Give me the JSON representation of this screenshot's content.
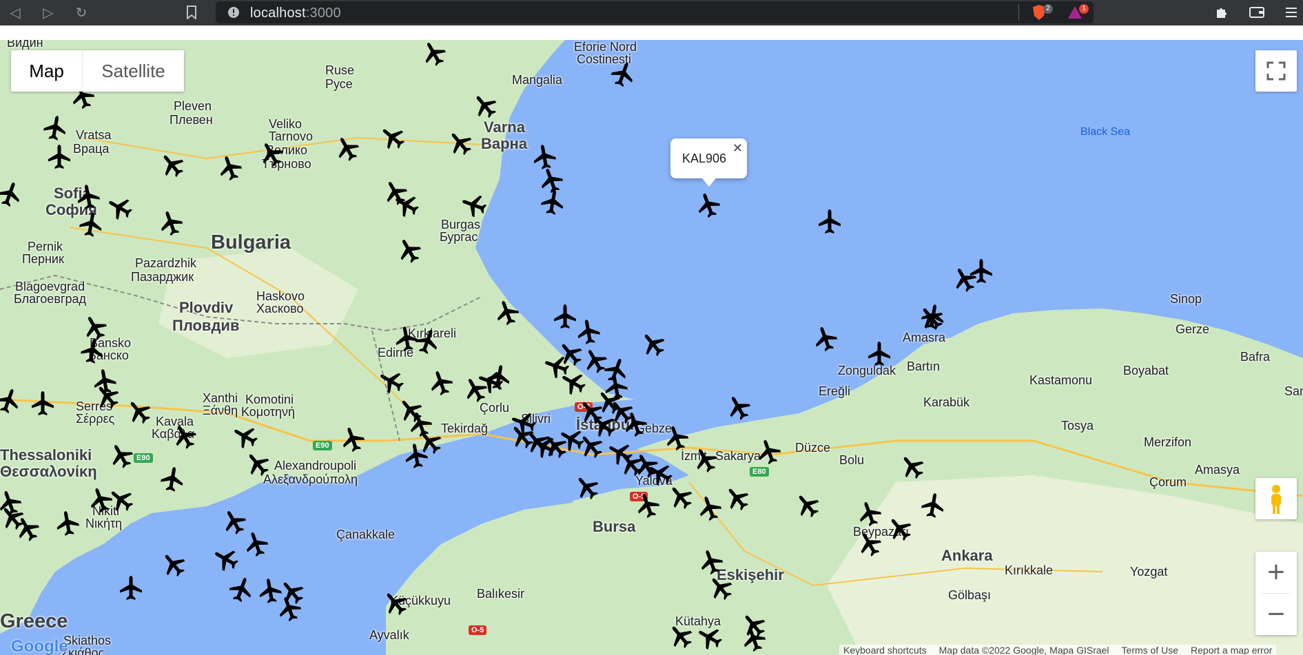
{
  "browser": {
    "url_host": "localhost",
    "url_port": ":3000",
    "brave_badge": "2",
    "rewards_badge": "1"
  },
  "map": {
    "type_control": {
      "map_label": "Map",
      "satellite_label": "Satellite",
      "selected": "Map"
    },
    "info_window": {
      "text": "KAL906"
    },
    "labels": [
      {
        "id": "vidin",
        "text": "Видин",
        "cls": ""
      },
      {
        "id": "eforie",
        "text": "Eforie Nord",
        "cls": ""
      },
      {
        "id": "costinesti",
        "text": "Costinesti",
        "cls": ""
      },
      {
        "id": "ruse",
        "text": "Ruse",
        "cls": ""
      },
      {
        "id": "ruse-cyr",
        "text": "Русе",
        "cls": ""
      },
      {
        "id": "mangalia",
        "text": "Mangalia",
        "cls": ""
      },
      {
        "id": "pleven",
        "text": "Pleven",
        "cls": ""
      },
      {
        "id": "pleven-cyr",
        "text": "Плевен",
        "cls": ""
      },
      {
        "id": "veliko",
        "text": "Veliko",
        "cls": ""
      },
      {
        "id": "tarnovo",
        "text": "Tarnovo",
        "cls": ""
      },
      {
        "id": "veliko-cyr",
        "text": "Велико",
        "cls": ""
      },
      {
        "id": "tarnovo-cyr",
        "text": "Търново",
        "cls": ""
      },
      {
        "id": "varna",
        "text": "Varna",
        "cls": "big"
      },
      {
        "id": "varna-cyr",
        "text": "Варна",
        "cls": "big"
      },
      {
        "id": "vratsa",
        "text": "Vratsa",
        "cls": ""
      },
      {
        "id": "vratsa-cyr",
        "text": "Враца",
        "cls": ""
      },
      {
        "id": "sofia",
        "text": "Sofia",
        "cls": "big"
      },
      {
        "id": "sofia-cyr",
        "text": "София",
        "cls": "big"
      },
      {
        "id": "burgas",
        "text": "Burgas",
        "cls": ""
      },
      {
        "id": "burgas-cyr",
        "text": "Бургас",
        "cls": ""
      },
      {
        "id": "pernik",
        "text": "Pernik",
        "cls": ""
      },
      {
        "id": "pernik-cyr",
        "text": "Перник",
        "cls": ""
      },
      {
        "id": "bulgaria",
        "text": "Bulgaria",
        "cls": "country"
      },
      {
        "id": "pazardzhik",
        "text": "Pazardzhik",
        "cls": ""
      },
      {
        "id": "pazardzhik-cyr",
        "text": "Пазарджик",
        "cls": ""
      },
      {
        "id": "blagoevgrad",
        "text": "Blagoevgrad",
        "cls": ""
      },
      {
        "id": "blagoevgrad-cyr",
        "text": "Благоевград",
        "cls": ""
      },
      {
        "id": "haskovo",
        "text": "Haskovo",
        "cls": ""
      },
      {
        "id": "haskovo-cyr",
        "text": "Хасково",
        "cls": ""
      },
      {
        "id": "plovdiv",
        "text": "Plovdiv",
        "cls": "big"
      },
      {
        "id": "plovdiv-cyr",
        "text": "Пловдив",
        "cls": "big"
      },
      {
        "id": "kirklareli",
        "text": "Kırklareli",
        "cls": ""
      },
      {
        "id": "bansko",
        "text": "Bansko",
        "cls": ""
      },
      {
        "id": "bansko-cyr",
        "text": "Банско",
        "cls": ""
      },
      {
        "id": "edirne",
        "text": "Edirne",
        "cls": ""
      },
      {
        "id": "xanthi",
        "text": "Xanthi",
        "cls": ""
      },
      {
        "id": "xanthi-gr",
        "text": "Ξάνθη",
        "cls": ""
      },
      {
        "id": "komotini",
        "text": "Komotini",
        "cls": ""
      },
      {
        "id": "komotini-gr",
        "text": "Κομοτηνή",
        "cls": ""
      },
      {
        "id": "serres",
        "text": "Serres",
        "cls": ""
      },
      {
        "id": "serres-gr",
        "text": "Σέρρες",
        "cls": ""
      },
      {
        "id": "kavala",
        "text": "Kavala",
        "cls": ""
      },
      {
        "id": "kavala-gr",
        "text": "Καβάλα",
        "cls": ""
      },
      {
        "id": "corlu",
        "text": "Çorlu",
        "cls": ""
      },
      {
        "id": "silivri",
        "text": "Silivri",
        "cls": ""
      },
      {
        "id": "tekirdag",
        "text": "Tekirdağ",
        "cls": ""
      },
      {
        "id": "istanbul",
        "text": "İstanbul",
        "cls": "big"
      },
      {
        "id": "gebze",
        "text": "Gebze",
        "cls": ""
      },
      {
        "id": "izmit",
        "text": "İzmit",
        "cls": ""
      },
      {
        "id": "sakarya",
        "text": "Sakarya",
        "cls": ""
      },
      {
        "id": "duzce",
        "text": "Düzce",
        "cls": ""
      },
      {
        "id": "thessaloniki",
        "text": "Thessaloniki",
        "cls": "big"
      },
      {
        "id": "thessaloniki-gr",
        "text": "Θεσσαλονίκη",
        "cls": "big"
      },
      {
        "id": "alexandroupoli",
        "text": "Alexandroupoli",
        "cls": ""
      },
      {
        "id": "alexandroupoli-gr",
        "text": "Αλεξανδρούπολη",
        "cls": ""
      },
      {
        "id": "nikiti",
        "text": "Nikiti",
        "cls": ""
      },
      {
        "id": "nikiti-gr",
        "text": "Νικήτη",
        "cls": ""
      },
      {
        "id": "canakkale",
        "text": "Çanakkale",
        "cls": ""
      },
      {
        "id": "yalova",
        "text": "Yalova",
        "cls": ""
      },
      {
        "id": "bursa",
        "text": "Bursa",
        "cls": "big"
      },
      {
        "id": "balikesir",
        "text": "Balıkesir",
        "cls": ""
      },
      {
        "id": "ayvalik",
        "text": "Ayvalık",
        "cls": ""
      },
      {
        "id": "kucukkuyu",
        "text": "Küçükkuyu",
        "cls": ""
      },
      {
        "id": "skiathos",
        "text": "Skiathos",
        "cls": ""
      },
      {
        "id": "skiathos-gr",
        "text": "Σκιάθος",
        "cls": ""
      },
      {
        "id": "greece",
        "text": "Greece",
        "cls": "country"
      },
      {
        "id": "eskisehir",
        "text": "Eskişehir",
        "cls": "big"
      },
      {
        "id": "kutahya",
        "text": "Kütahya",
        "cls": ""
      },
      {
        "id": "bolu",
        "text": "Bolu",
        "cls": ""
      },
      {
        "id": "beypazari",
        "text": "Beypazarı",
        "cls": ""
      },
      {
        "id": "ankara",
        "text": "Ankara",
        "cls": "big"
      },
      {
        "id": "golbasi",
        "text": "Gölbaşı",
        "cls": ""
      },
      {
        "id": "kirikkale",
        "text": "Kırıkkale",
        "cls": ""
      },
      {
        "id": "yozgat",
        "text": "Yozgat",
        "cls": ""
      },
      {
        "id": "corum",
        "text": "Çorum",
        "cls": ""
      },
      {
        "id": "amasya",
        "text": "Amasya",
        "cls": ""
      },
      {
        "id": "merzifon",
        "text": "Merzifon",
        "cls": ""
      },
      {
        "id": "tosya",
        "text": "Tosya",
        "cls": ""
      },
      {
        "id": "karabuk",
        "text": "Karabük",
        "cls": ""
      },
      {
        "id": "kastamonu",
        "text": "Kastamonu",
        "cls": ""
      },
      {
        "id": "bartin",
        "text": "Bartın",
        "cls": ""
      },
      {
        "id": "amasra",
        "text": "Amasra",
        "cls": ""
      },
      {
        "id": "zonguldak",
        "text": "Zonguldak",
        "cls": ""
      },
      {
        "id": "eregli",
        "text": "Ereğli",
        "cls": ""
      },
      {
        "id": "boyabat",
        "text": "Boyabat",
        "cls": ""
      },
      {
        "id": "sinop",
        "text": "Sinop",
        "cls": ""
      },
      {
        "id": "gerze",
        "text": "Gerze",
        "cls": ""
      },
      {
        "id": "bafra",
        "text": "Bafra",
        "cls": ""
      },
      {
        "id": "samsun",
        "text": "Samsun",
        "cls": ""
      },
      {
        "id": "black-sea",
        "text": "Black Sea",
        "cls": "sea"
      }
    ],
    "road_badges": [
      {
        "id": "e90a",
        "text": "E90",
        "color": "#34a853"
      },
      {
        "id": "e90b",
        "text": "E90",
        "color": "#34a853"
      },
      {
        "id": "e80",
        "text": "E80",
        "color": "#34a853"
      },
      {
        "id": "o7",
        "text": "O-7",
        "color": "#d93025"
      },
      {
        "id": "o5a",
        "text": "O-5",
        "color": "#d93025"
      },
      {
        "id": "o5b",
        "text": "O-5",
        "color": "#d93025"
      }
    ],
    "footer": {
      "keyboard": "Keyboard shortcuts",
      "mapdata": "Map data ©2022 Google, Mapa GISrael",
      "terms": "Terms of Use",
      "report": "Report a map error"
    },
    "logo": "Google",
    "zoom_in": "+",
    "zoom_out": "−",
    "colors": {
      "water": "#8ab4f8",
      "land": "#cde8c0",
      "land_light": "#e8f0d8",
      "plane": "#000000"
    }
  }
}
